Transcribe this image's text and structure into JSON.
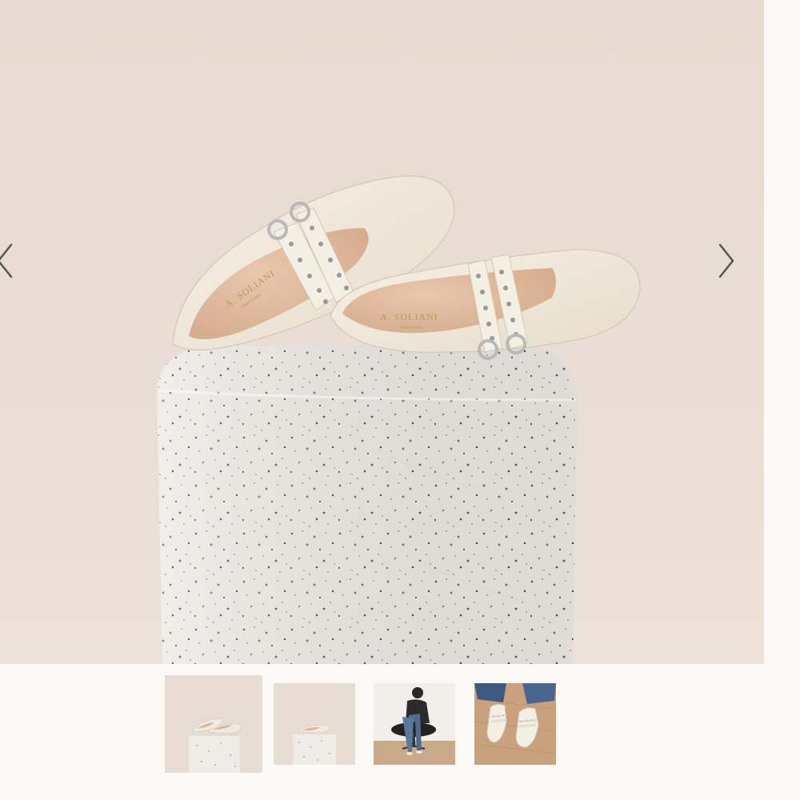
{
  "gallery": {
    "main_image": {
      "subject": "cream leather double-strap mary jane flats on a terrazzo plinth",
      "brand_logo_text": "A. SOLIANI",
      "brand_logo_subtext": "made in italy"
    },
    "prev_icon": "chevron-left-icon",
    "next_icon": "chevron-right-icon",
    "thumbnails": [
      {
        "label": "shoes-on-plinth-front",
        "selected": true
      },
      {
        "label": "single-shoe-on-plinth",
        "selected": false
      },
      {
        "label": "model-seated-in-chair",
        "selected": false
      },
      {
        "label": "worn-on-feet-wood-floor",
        "selected": false
      }
    ]
  },
  "colors": {
    "background": "#fdf9f6",
    "backdrop": "#e8ddd3",
    "shoe_leather": "#f1ebdd",
    "shoe_lining": "#e1bb9f",
    "chevron": "#555555"
  }
}
